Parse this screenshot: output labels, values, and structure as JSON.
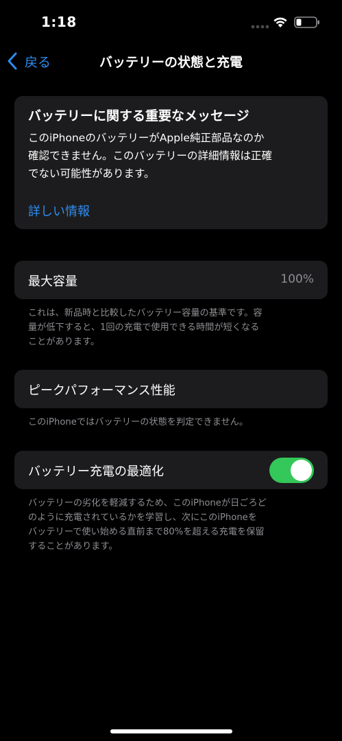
{
  "status_bar": {
    "time": "1:18"
  },
  "nav": {
    "back_label": "戻る",
    "title": "バッテリーの状態と充電"
  },
  "message": {
    "title": "バッテリーに関する重要なメッセージ",
    "body_lines": [
      "このiPhoneのバッテリーがApple純正部品なのか",
      "確認できません。このバッテリーの詳細情報は正確",
      "でない可能性があります。"
    ],
    "link": "詳しい情報"
  },
  "max_capacity": {
    "label": "最大容量",
    "value": "100%",
    "footnote_lines": [
      "これは、新品時と比較したバッテリー容量の基準です。容",
      "量が低下すると、1回の充電で使用できる時間が短くなる",
      "ことがあります。"
    ]
  },
  "peak_performance": {
    "label": "ピークパフォーマンス性能",
    "footnote_lines": [
      "このiPhoneではバッテリーの状態を判定できません。"
    ]
  },
  "optimized_charging": {
    "label": "バッテリー充電の最適化",
    "enabled": true,
    "footnote_lines": [
      "バッテリーの劣化を軽減するため、このiPhoneが日ごろど",
      "のように充電されているかを学習し、次にこのiPhoneを",
      "バッテリーで使い始める直前まで80%を超える充電を保留",
      "することがあります。"
    ]
  },
  "colors": {
    "background": "#000000",
    "card": "#1c1c1e",
    "accent_blue": "#2f8cf0",
    "toggle_on": "#34c759",
    "secondary_text": "#8e8e93"
  }
}
